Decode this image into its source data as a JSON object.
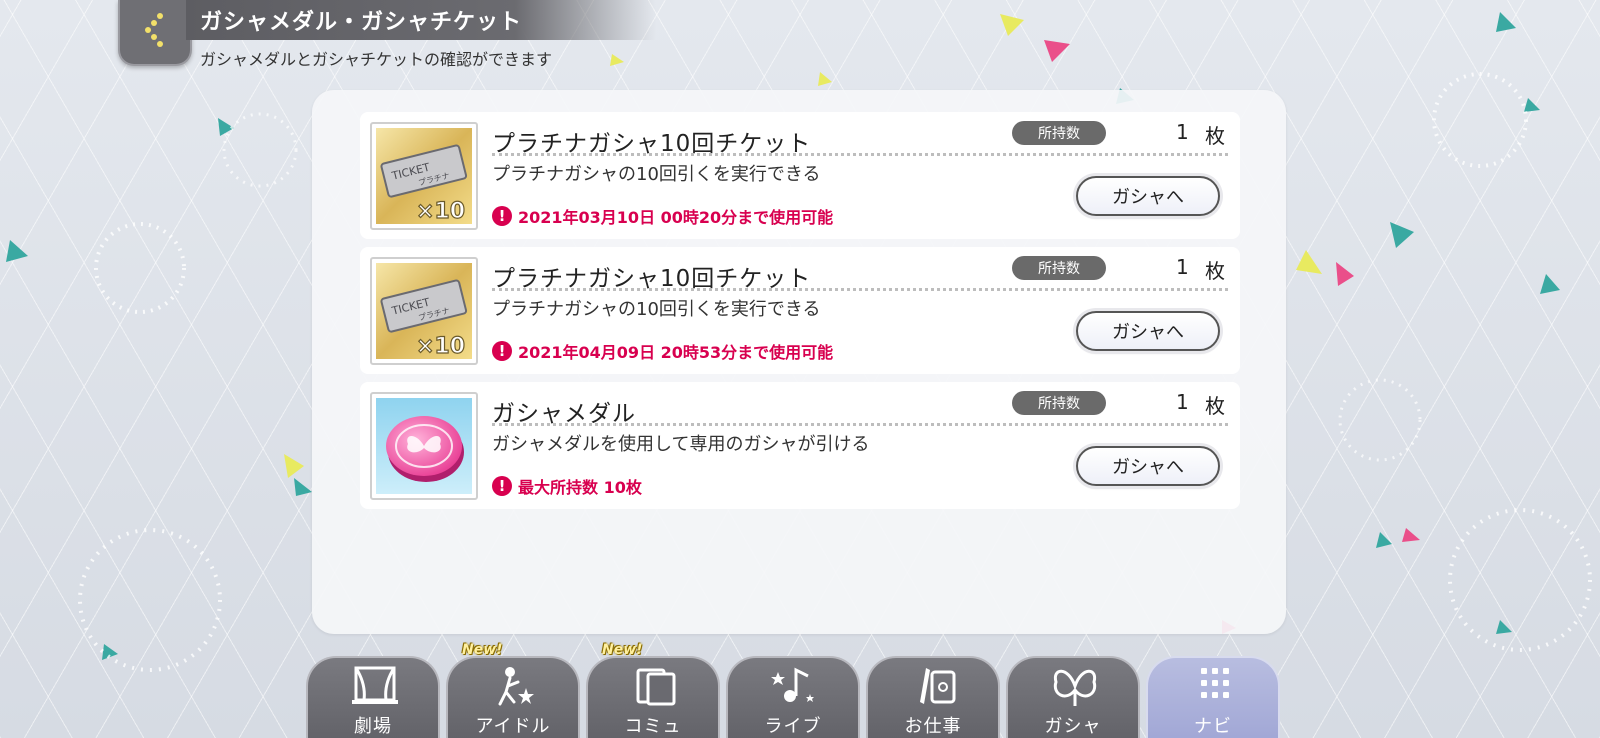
{
  "header": {
    "title": "ガシャメダル・ガシャチケット",
    "subtitle": "ガシャメダルとガシャチケットの確認ができます",
    "back_icon": "chevron-left-icon"
  },
  "items": [
    {
      "name": "プラチナガシャ10回チケット",
      "owned_label": "所持数",
      "count": "1",
      "unit": "枚",
      "description": "プラチナガシャの10回引くを実行できる",
      "notice": "2021年03月10日 00時20分まで使用可能",
      "button_label": "ガシャへ",
      "thumb_text": "TICKET",
      "thumb_sub": "プラチナ",
      "thumb_multiplier": "×10"
    },
    {
      "name": "プラチナガシャ10回チケット",
      "owned_label": "所持数",
      "count": "1",
      "unit": "枚",
      "description": "プラチナガシャの10回引くを実行できる",
      "notice": "2021年04月09日 20時53分まで使用可能",
      "button_label": "ガシャへ",
      "thumb_text": "TICKET",
      "thumb_sub": "プラチナ",
      "thumb_multiplier": "×10"
    },
    {
      "name": "ガシャメダル",
      "owned_label": "所持数",
      "count": "1",
      "unit": "枚",
      "description": "ガシャメダルを使用して専用のガシャが引ける",
      "notice": "最大所持数 10枚",
      "button_label": "ガシャへ"
    }
  ],
  "notice_icon": "!",
  "nav": {
    "new_badge": "New!",
    "tabs": [
      {
        "label": "劇場",
        "icon": "theater-icon"
      },
      {
        "label": "アイドル",
        "icon": "idol-icon"
      },
      {
        "label": "コミュ",
        "icon": "commu-icon"
      },
      {
        "label": "ライブ",
        "icon": "live-icon"
      },
      {
        "label": "お仕事",
        "icon": "work-icon"
      },
      {
        "label": "ガシャ",
        "icon": "gacha-icon"
      },
      {
        "label": "ナビ",
        "icon": "navi-icon"
      }
    ]
  },
  "colors": {
    "accent_red": "#d8004f",
    "header_gray": "#5d5d62",
    "nav_active": "#a6acd8"
  }
}
